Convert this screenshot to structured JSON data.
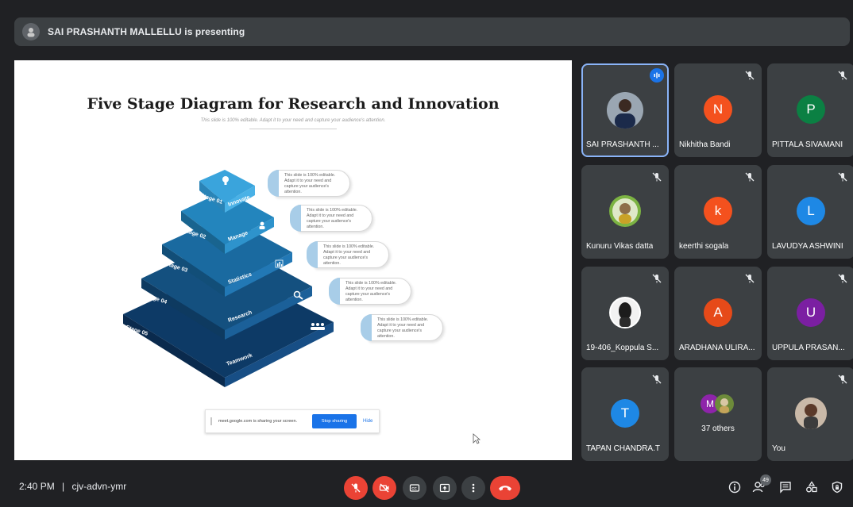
{
  "presenting_bar": {
    "text": "SAI PRASHANTH MALLELLU is presenting"
  },
  "slide": {
    "title": "Five Stage Diagram for Research and Innovation",
    "subtitle": "This slide is 100% editable. Adapt it to your need and capture your audience's attention.",
    "stages": [
      {
        "stage": "Stage 01",
        "label": "Innovate"
      },
      {
        "stage": "Stage 02",
        "label": "Manage"
      },
      {
        "stage": "Stage 03",
        "label": "Statistics"
      },
      {
        "stage": "Stage 04",
        "label": "Research"
      },
      {
        "stage": "Stage 05",
        "label": "Teamwork"
      }
    ],
    "callouts": [
      "This slide is 100% editable. Adapt it to your need and capture your audience's attention.",
      "This slide is 100% editable. Adapt it to your need and capture your audience's attention.",
      "This slide is 100% editable. Adapt it to your need and capture your audience's attention.",
      "This slide is 100% editable. Adapt it to your need and capture your audience's attention.",
      "This slide is 100% editable. Adapt it to your need and capture your audience's attention."
    ],
    "share_notice": {
      "text": "meet.google.com is sharing your screen.",
      "stop_label": "Stop sharing",
      "hide_label": "Hide"
    }
  },
  "participants": [
    {
      "name": "SAI PRASHANTH ...",
      "initial": "",
      "color": "",
      "photo": true,
      "speaking": true
    },
    {
      "name": "Nikhitha Bandi",
      "initial": "N",
      "color": "#f4511e",
      "photo": false
    },
    {
      "name": "PITTALA SIVAMANI",
      "initial": "P",
      "color": "#0b8043",
      "photo": false
    },
    {
      "name": "Kunuru Vikas datta",
      "initial": "",
      "color": "",
      "photo": true
    },
    {
      "name": "keerthi sogala",
      "initial": "k",
      "color": "#f4511e",
      "photo": false
    },
    {
      "name": "LAVUDYA ASHWINI",
      "initial": "L",
      "color": "#1e88e5",
      "photo": false
    },
    {
      "name": "19-406_Koppula S...",
      "initial": "",
      "color": "",
      "photo": true
    },
    {
      "name": "ARADHANA ULIRA...",
      "initial": "A",
      "color": "#e64a19",
      "photo": false
    },
    {
      "name": "UPPULA PRASAN...",
      "initial": "U",
      "color": "#7b1fa2",
      "photo": false
    },
    {
      "name": "TAPAN CHANDRA.T",
      "initial": "T",
      "color": "#1e88e5",
      "photo": false
    },
    {
      "name": "37 others",
      "initial": "M",
      "color": "#8e24aa",
      "photo": false
    },
    {
      "name": "You",
      "initial": "",
      "color": "",
      "photo": true
    }
  ],
  "bottom_bar": {
    "time": "2:40 PM",
    "separator": "|",
    "meeting_code": "cjv-advn-ymr",
    "participant_count": "49",
    "end_color": "#ea4335",
    "icons": [
      "mic-off-icon",
      "camera-off-icon",
      "captions-icon",
      "present-icon",
      "more-options-icon",
      "end-call-icon",
      "info-icon",
      "people-icon",
      "chat-icon",
      "activities-icon",
      "host-controls-icon"
    ]
  }
}
